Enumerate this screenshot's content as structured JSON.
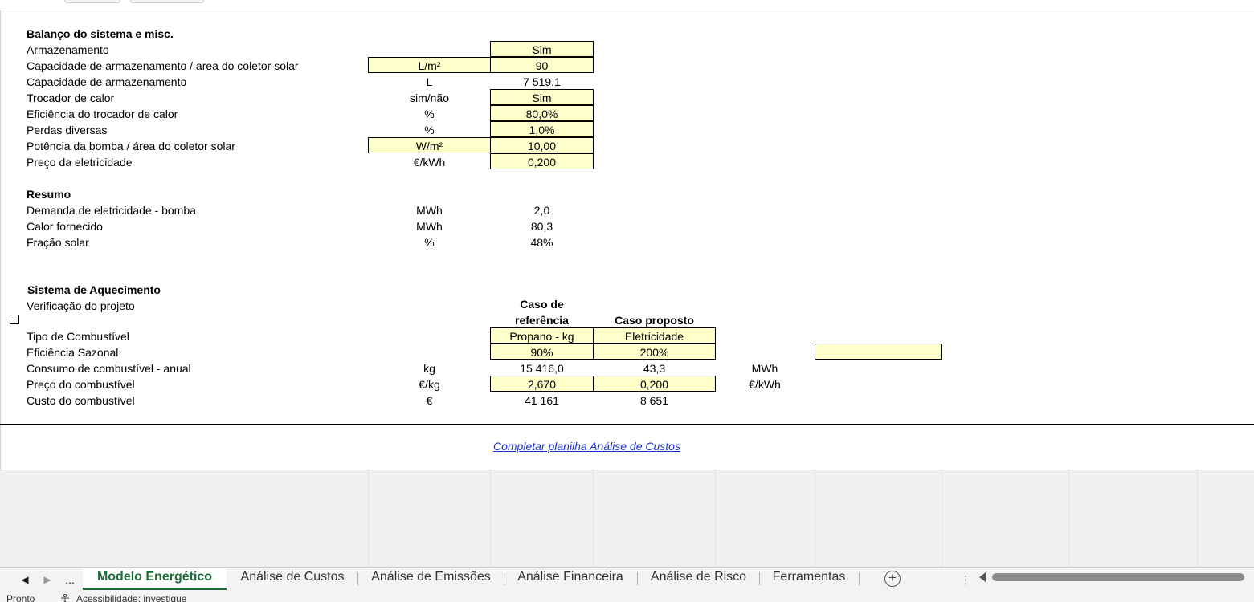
{
  "balanco": {
    "header": "Balanço do sistema e misc.",
    "rows": [
      {
        "label": "Armazenamento",
        "unit": "",
        "value": "Sim"
      },
      {
        "label": "Capacidade de armazenamento / area do coletor solar",
        "unit": "L/m²",
        "value": "90"
      },
      {
        "label": "Capacidade de armazenamento",
        "unit": "L",
        "value": "7 519,1"
      },
      {
        "label": "Trocador de calor",
        "unit": "sim/não",
        "value": "Sim"
      },
      {
        "label": "Eficiência do trocador de calor",
        "unit": "%",
        "value": "80,0%"
      },
      {
        "label": "Perdas diversas",
        "unit": "%",
        "value": "1,0%"
      },
      {
        "label": "Potência da bomba / área do coletor solar",
        "unit": "W/m²",
        "value": "10,00"
      },
      {
        "label": "Preço da eletricidade",
        "unit": "€/kWh",
        "value": "0,200"
      }
    ]
  },
  "resumo": {
    "header": "Resumo",
    "rows": [
      {
        "label": "Demanda de eletricidade - bomba",
        "unit": "MWh",
        "value": "2,0"
      },
      {
        "label": "Calor fornecido",
        "unit": "MWh",
        "value": "80,3"
      },
      {
        "label": "Fração solar",
        "unit": "%",
        "value": "48%"
      }
    ]
  },
  "aquecimento": {
    "header": "Sistema de Aquecimento",
    "verificacao": "Verificação do projeto",
    "col_ref_line1": "Caso de",
    "col_ref_line2": "referência",
    "col_prop": "Caso proposto",
    "rows": [
      {
        "label": "Tipo de Combustível",
        "unit": "",
        "ref": "Propano - kg",
        "prop": "Eletricidade",
        "unit2": ""
      },
      {
        "label": "Eficiência Sazonal",
        "unit": "",
        "ref": "90%",
        "prop": "200%",
        "unit2": ""
      },
      {
        "label": "Consumo de combustível - anual",
        "unit": "kg",
        "ref": "15 416,0",
        "prop": "43,3",
        "unit2": "MWh"
      },
      {
        "label": "Preço do combustível",
        "unit": "€/kg",
        "ref": "2,670",
        "prop": "0,200",
        "unit2": "€/kWh"
      },
      {
        "label": "Custo do combustível",
        "unit": "€",
        "ref": "41 161",
        "prop": "8 651",
        "unit2": ""
      }
    ]
  },
  "link": "Completar planilha Análise de Custos",
  "tabs": {
    "ellipsis": "...",
    "items": [
      "Modelo Energético",
      "Análise de Custos",
      "Análise de Emissões",
      "Análise Financeira",
      "Análise de Risco",
      "Ferramentas"
    ],
    "add": "+"
  },
  "status": {
    "ready": "Pronto",
    "accessibility": "Acessibilidade: investigue"
  },
  "colors": {
    "input_fill": "#ffffcc",
    "active_tab": "#1e6b3a",
    "link": "#1a2fd0"
  }
}
